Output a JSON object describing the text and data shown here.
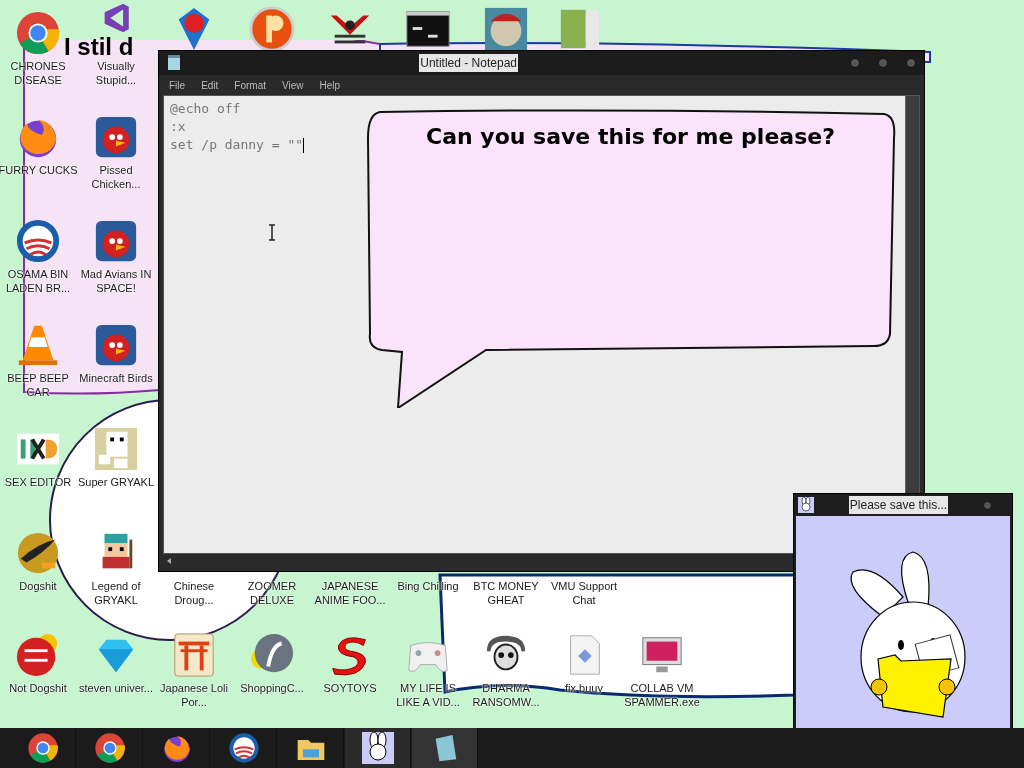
{
  "wallpaper_text": "I stil d",
  "desktop_icons": [
    {
      "label": "CHRONES DISEASE"
    },
    {
      "label": "Visually Stupid..."
    },
    {
      "label": "FURRY CUCKS"
    },
    {
      "label": "Pissed Chicken..."
    },
    {
      "label": "OSAMA BIN LADEN BR..."
    },
    {
      "label": "Mad Avians IN SPACE!"
    },
    {
      "label": "BEEP BEEP CAR"
    },
    {
      "label": "Minecraft Birds"
    },
    {
      "label": "SEX EDITOR"
    },
    {
      "label": "Super GRYAKL"
    },
    {
      "label": "Dogshit"
    },
    {
      "label": "Legend of GRYAKL"
    },
    {
      "label": "Chinese Droug..."
    },
    {
      "label": "ZOOMER DELUXE"
    },
    {
      "label": "JAPANESE ANIME FOO..."
    },
    {
      "label": "Bing Chilling"
    },
    {
      "label": "BTC MONEY GHEAT"
    },
    {
      "label": "VMU Support Chat"
    },
    {
      "label": "Not Dogshit"
    },
    {
      "label": "steven univer..."
    },
    {
      "label": "Japanese Loli Por..."
    },
    {
      "label": "ShoppingC..."
    },
    {
      "label": "SOYTOYS"
    },
    {
      "label": "MY LIFE IS LIKE A VID..."
    },
    {
      "label": "DHARMA RANSOMW..."
    },
    {
      "label": "fix buuy"
    },
    {
      "label": "COLLAB VM SPAMMER.exe"
    }
  ],
  "notepad": {
    "title": "Untitled - Notepad",
    "menu": [
      "File",
      "Edit",
      "Format",
      "View",
      "Help"
    ],
    "lines": [
      "@echo off",
      ":x",
      "set /p danny = \"\""
    ],
    "speech_bubble": "Can you save this for me please?"
  },
  "popup": {
    "title": "Please save this..."
  }
}
